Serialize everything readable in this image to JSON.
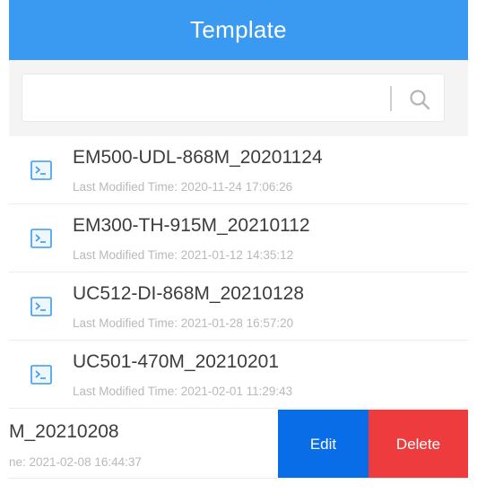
{
  "header": {
    "title": "Template"
  },
  "search": {
    "value": "",
    "placeholder": "",
    "icon": "search-icon"
  },
  "colors": {
    "header": "#3a99f0",
    "edit": "#0a6de8",
    "delete": "#ee3b3e"
  },
  "templates": [
    {
      "name": "EM500-UDL-868M_20201124",
      "modified": "Last Modified Time: 2020-11-24 17:06:26",
      "icon": "terminal-file-icon"
    },
    {
      "name": "EM300-TH-915M_20210112",
      "modified": "Last Modified Time: 2021-01-12 14:35:12",
      "icon": "terminal-file-icon"
    },
    {
      "name": "UC512-DI-868M_20210128",
      "modified": "Last Modified Time: 2021-01-28 16:57:20",
      "icon": "terminal-file-icon"
    },
    {
      "name": "UC501-470M_20210201",
      "modified": "Last Modified Time: 2021-02-01 11:29:43",
      "icon": "terminal-file-icon"
    }
  ],
  "swiped_item": {
    "name": "M_20210208",
    "modified": "ne: 2021-02-08 16:44:37",
    "actions": {
      "edit": "Edit",
      "delete": "Delete"
    }
  }
}
